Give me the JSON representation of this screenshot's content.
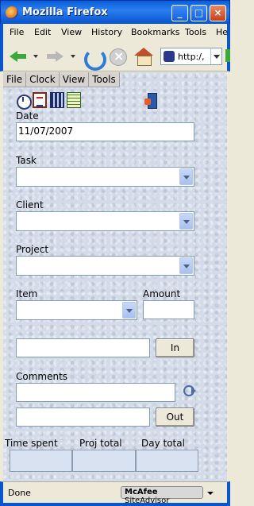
{
  "window": {
    "title": "Mozilla Firefox",
    "minimize_glyph": "_",
    "maximize_glyph": "□",
    "close_glyph": "×"
  },
  "browser_menu": [
    "File",
    "Edit",
    "View",
    "History",
    "Bookmarks",
    "Tools",
    "He"
  ],
  "navigation": {
    "url": "http:/,"
  },
  "app_menu": [
    "File",
    "Clock",
    "View",
    "Tools"
  ],
  "tool_icons": [
    "clock-icon",
    "form-icon",
    "grid-icon",
    "sheet-icon",
    "exit-icon"
  ],
  "form": {
    "date_label": "Date",
    "date_value": "11/07/2007",
    "task_label": "Task",
    "client_label": "Client",
    "project_label": "Project",
    "item_label": "Item",
    "amount_label": "Amount",
    "in_button": "In",
    "comments_label": "Comments",
    "out_button": "Out"
  },
  "totals": {
    "time_spent_label": "Time spent",
    "proj_total_label": "Proj total",
    "day_total_label": "Day total"
  },
  "status": {
    "text": "Done",
    "addon_brand": "McAfee",
    "addon_product": "SiteAdvisor"
  }
}
